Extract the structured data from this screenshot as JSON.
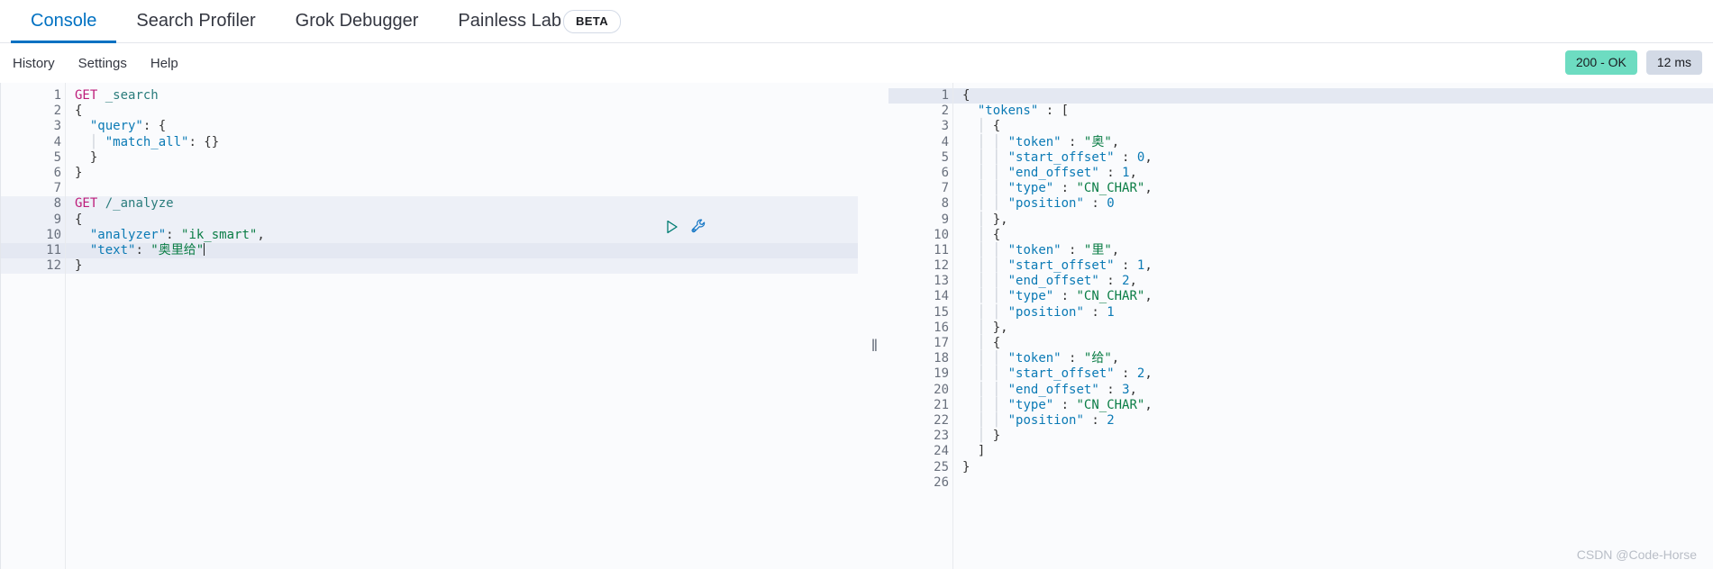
{
  "tabs": [
    {
      "label": "Console",
      "active": true
    },
    {
      "label": "Search Profiler",
      "active": false
    },
    {
      "label": "Grok Debugger",
      "active": false
    },
    {
      "label": "Painless Lab",
      "active": false
    }
  ],
  "beta_badge": "BETA",
  "subnav": [
    {
      "label": "History"
    },
    {
      "label": "Settings"
    },
    {
      "label": "Help"
    }
  ],
  "status": {
    "code": "200 - OK",
    "time": "12 ms",
    "ok_color": "#6ddcc1",
    "time_color": "#d3dae6"
  },
  "request_editor": {
    "lines": [
      {
        "n": "1",
        "fold": "",
        "highlight": "none",
        "tokens": [
          {
            "t": "GET",
            "c": "method"
          },
          {
            "t": " ",
            "c": "punct"
          },
          {
            "t": "_search",
            "c": "url"
          }
        ]
      },
      {
        "n": "2",
        "fold": "▾",
        "highlight": "none",
        "tokens": [
          {
            "t": "{",
            "c": "punct"
          }
        ]
      },
      {
        "n": "3",
        "fold": "▾",
        "highlight": "none",
        "tokens": [
          {
            "t": "  ",
            "c": "punct"
          },
          {
            "t": "\"query\"",
            "c": "key"
          },
          {
            "t": ": {",
            "c": "punct"
          }
        ]
      },
      {
        "n": "4",
        "fold": "",
        "highlight": "none",
        "tokens": [
          {
            "t": "  ",
            "c": "punct"
          },
          {
            "t": "│",
            "c": "guide"
          },
          {
            "t": " ",
            "c": "punct"
          },
          {
            "t": "\"match_all\"",
            "c": "key"
          },
          {
            "t": ": {}",
            "c": "punct"
          }
        ]
      },
      {
        "n": "5",
        "fold": "▴",
        "highlight": "none",
        "tokens": [
          {
            "t": "  }",
            "c": "punct"
          }
        ]
      },
      {
        "n": "6",
        "fold": "▴",
        "highlight": "none",
        "tokens": [
          {
            "t": "}",
            "c": "punct"
          }
        ]
      },
      {
        "n": "7",
        "fold": "",
        "highlight": "none",
        "tokens": []
      },
      {
        "n": "8",
        "fold": "",
        "highlight": "soft",
        "tokens": [
          {
            "t": "GET",
            "c": "method"
          },
          {
            "t": " ",
            "c": "punct"
          },
          {
            "t": "/_analyze",
            "c": "url"
          }
        ]
      },
      {
        "n": "9",
        "fold": "▾",
        "highlight": "soft",
        "tokens": [
          {
            "t": "{",
            "c": "punct"
          }
        ]
      },
      {
        "n": "10",
        "fold": "",
        "highlight": "soft",
        "tokens": [
          {
            "t": "  ",
            "c": "punct"
          },
          {
            "t": "\"analyzer\"",
            "c": "key"
          },
          {
            "t": ": ",
            "c": "punct"
          },
          {
            "t": "\"ik_smart\"",
            "c": "str"
          },
          {
            "t": ",",
            "c": "punct"
          }
        ]
      },
      {
        "n": "11",
        "fold": "",
        "highlight": "strong",
        "caret": true,
        "tokens": [
          {
            "t": "  ",
            "c": "punct"
          },
          {
            "t": "\"text\"",
            "c": "key"
          },
          {
            "t": ": ",
            "c": "punct"
          },
          {
            "t": "\"奥里给\"",
            "c": "str"
          }
        ]
      },
      {
        "n": "12",
        "fold": "▴",
        "highlight": "soft",
        "tokens": [
          {
            "t": "}",
            "c": "punct"
          }
        ]
      }
    ],
    "play_icon": "play-icon",
    "wrench_icon": "wrench-icon"
  },
  "response_editor": {
    "lines": [
      {
        "n": "1",
        "fold": "▾",
        "highlight": "strong",
        "tokens": [
          {
            "t": "{",
            "c": "punct"
          }
        ]
      },
      {
        "n": "2",
        "fold": "▾",
        "highlight": "none",
        "tokens": [
          {
            "t": "  ",
            "c": "punct"
          },
          {
            "t": "\"tokens\"",
            "c": "key"
          },
          {
            "t": " : [",
            "c": "punct"
          }
        ]
      },
      {
        "n": "3",
        "fold": "▾",
        "highlight": "none",
        "tokens": [
          {
            "t": "  ",
            "c": "punct"
          },
          {
            "t": "│",
            "c": "guide"
          },
          {
            "t": " {",
            "c": "punct"
          }
        ]
      },
      {
        "n": "4",
        "fold": "",
        "highlight": "none",
        "tokens": [
          {
            "t": "  ",
            "c": "punct"
          },
          {
            "t": "│",
            "c": "guide"
          },
          {
            "t": " ",
            "c": "punct"
          },
          {
            "t": "│",
            "c": "guide"
          },
          {
            "t": " ",
            "c": "punct"
          },
          {
            "t": "\"token\"",
            "c": "key"
          },
          {
            "t": " : ",
            "c": "punct"
          },
          {
            "t": "\"奥\"",
            "c": "str"
          },
          {
            "t": ",",
            "c": "punct"
          }
        ]
      },
      {
        "n": "5",
        "fold": "",
        "highlight": "none",
        "tokens": [
          {
            "t": "  ",
            "c": "punct"
          },
          {
            "t": "│",
            "c": "guide"
          },
          {
            "t": " ",
            "c": "punct"
          },
          {
            "t": "│",
            "c": "guide"
          },
          {
            "t": " ",
            "c": "punct"
          },
          {
            "t": "\"start_offset\"",
            "c": "key"
          },
          {
            "t": " : ",
            "c": "punct"
          },
          {
            "t": "0",
            "c": "num"
          },
          {
            "t": ",",
            "c": "punct"
          }
        ]
      },
      {
        "n": "6",
        "fold": "",
        "highlight": "none",
        "tokens": [
          {
            "t": "  ",
            "c": "punct"
          },
          {
            "t": "│",
            "c": "guide"
          },
          {
            "t": " ",
            "c": "punct"
          },
          {
            "t": "│",
            "c": "guide"
          },
          {
            "t": " ",
            "c": "punct"
          },
          {
            "t": "\"end_offset\"",
            "c": "key"
          },
          {
            "t": " : ",
            "c": "punct"
          },
          {
            "t": "1",
            "c": "num"
          },
          {
            "t": ",",
            "c": "punct"
          }
        ]
      },
      {
        "n": "7",
        "fold": "",
        "highlight": "none",
        "tokens": [
          {
            "t": "  ",
            "c": "punct"
          },
          {
            "t": "│",
            "c": "guide"
          },
          {
            "t": " ",
            "c": "punct"
          },
          {
            "t": "│",
            "c": "guide"
          },
          {
            "t": " ",
            "c": "punct"
          },
          {
            "t": "\"type\"",
            "c": "key"
          },
          {
            "t": " : ",
            "c": "punct"
          },
          {
            "t": "\"CN_CHAR\"",
            "c": "str"
          },
          {
            "t": ",",
            "c": "punct"
          }
        ]
      },
      {
        "n": "8",
        "fold": "",
        "highlight": "none",
        "tokens": [
          {
            "t": "  ",
            "c": "punct"
          },
          {
            "t": "│",
            "c": "guide"
          },
          {
            "t": " ",
            "c": "punct"
          },
          {
            "t": "│",
            "c": "guide"
          },
          {
            "t": " ",
            "c": "punct"
          },
          {
            "t": "\"position\"",
            "c": "key"
          },
          {
            "t": " : ",
            "c": "punct"
          },
          {
            "t": "0",
            "c": "num"
          }
        ]
      },
      {
        "n": "9",
        "fold": "▴",
        "highlight": "none",
        "tokens": [
          {
            "t": "  ",
            "c": "punct"
          },
          {
            "t": "│",
            "c": "guide"
          },
          {
            "t": " },",
            "c": "punct"
          }
        ]
      },
      {
        "n": "10",
        "fold": "▾",
        "highlight": "none",
        "tokens": [
          {
            "t": "  ",
            "c": "punct"
          },
          {
            "t": "│",
            "c": "guide"
          },
          {
            "t": " {",
            "c": "punct"
          }
        ]
      },
      {
        "n": "11",
        "fold": "",
        "highlight": "none",
        "tokens": [
          {
            "t": "  ",
            "c": "punct"
          },
          {
            "t": "│",
            "c": "guide"
          },
          {
            "t": " ",
            "c": "punct"
          },
          {
            "t": "│",
            "c": "guide"
          },
          {
            "t": " ",
            "c": "punct"
          },
          {
            "t": "\"token\"",
            "c": "key"
          },
          {
            "t": " : ",
            "c": "punct"
          },
          {
            "t": "\"里\"",
            "c": "str"
          },
          {
            "t": ",",
            "c": "punct"
          }
        ]
      },
      {
        "n": "12",
        "fold": "",
        "highlight": "none",
        "tokens": [
          {
            "t": "  ",
            "c": "punct"
          },
          {
            "t": "│",
            "c": "guide"
          },
          {
            "t": " ",
            "c": "punct"
          },
          {
            "t": "│",
            "c": "guide"
          },
          {
            "t": " ",
            "c": "punct"
          },
          {
            "t": "\"start_offset\"",
            "c": "key"
          },
          {
            "t": " : ",
            "c": "punct"
          },
          {
            "t": "1",
            "c": "num"
          },
          {
            "t": ",",
            "c": "punct"
          }
        ]
      },
      {
        "n": "13",
        "fold": "",
        "highlight": "none",
        "tokens": [
          {
            "t": "  ",
            "c": "punct"
          },
          {
            "t": "│",
            "c": "guide"
          },
          {
            "t": " ",
            "c": "punct"
          },
          {
            "t": "│",
            "c": "guide"
          },
          {
            "t": " ",
            "c": "punct"
          },
          {
            "t": "\"end_offset\"",
            "c": "key"
          },
          {
            "t": " : ",
            "c": "punct"
          },
          {
            "t": "2",
            "c": "num"
          },
          {
            "t": ",",
            "c": "punct"
          }
        ]
      },
      {
        "n": "14",
        "fold": "",
        "highlight": "none",
        "tokens": [
          {
            "t": "  ",
            "c": "punct"
          },
          {
            "t": "│",
            "c": "guide"
          },
          {
            "t": " ",
            "c": "punct"
          },
          {
            "t": "│",
            "c": "guide"
          },
          {
            "t": " ",
            "c": "punct"
          },
          {
            "t": "\"type\"",
            "c": "key"
          },
          {
            "t": " : ",
            "c": "punct"
          },
          {
            "t": "\"CN_CHAR\"",
            "c": "str"
          },
          {
            "t": ",",
            "c": "punct"
          }
        ]
      },
      {
        "n": "15",
        "fold": "",
        "highlight": "none",
        "tokens": [
          {
            "t": "  ",
            "c": "punct"
          },
          {
            "t": "│",
            "c": "guide"
          },
          {
            "t": " ",
            "c": "punct"
          },
          {
            "t": "│",
            "c": "guide"
          },
          {
            "t": " ",
            "c": "punct"
          },
          {
            "t": "\"position\"",
            "c": "key"
          },
          {
            "t": " : ",
            "c": "punct"
          },
          {
            "t": "1",
            "c": "num"
          }
        ]
      },
      {
        "n": "16",
        "fold": "▴",
        "highlight": "none",
        "tokens": [
          {
            "t": "  ",
            "c": "punct"
          },
          {
            "t": "│",
            "c": "guide"
          },
          {
            "t": " },",
            "c": "punct"
          }
        ]
      },
      {
        "n": "17",
        "fold": "▾",
        "highlight": "none",
        "tokens": [
          {
            "t": "  ",
            "c": "punct"
          },
          {
            "t": "│",
            "c": "guide"
          },
          {
            "t": " {",
            "c": "punct"
          }
        ]
      },
      {
        "n": "18",
        "fold": "",
        "highlight": "none",
        "tokens": [
          {
            "t": "  ",
            "c": "punct"
          },
          {
            "t": "│",
            "c": "guide"
          },
          {
            "t": " ",
            "c": "punct"
          },
          {
            "t": "│",
            "c": "guide"
          },
          {
            "t": " ",
            "c": "punct"
          },
          {
            "t": "\"token\"",
            "c": "key"
          },
          {
            "t": " : ",
            "c": "punct"
          },
          {
            "t": "\"给\"",
            "c": "str"
          },
          {
            "t": ",",
            "c": "punct"
          }
        ]
      },
      {
        "n": "19",
        "fold": "",
        "highlight": "none",
        "tokens": [
          {
            "t": "  ",
            "c": "punct"
          },
          {
            "t": "│",
            "c": "guide"
          },
          {
            "t": " ",
            "c": "punct"
          },
          {
            "t": "│",
            "c": "guide"
          },
          {
            "t": " ",
            "c": "punct"
          },
          {
            "t": "\"start_offset\"",
            "c": "key"
          },
          {
            "t": " : ",
            "c": "punct"
          },
          {
            "t": "2",
            "c": "num"
          },
          {
            "t": ",",
            "c": "punct"
          }
        ]
      },
      {
        "n": "20",
        "fold": "",
        "highlight": "none",
        "tokens": [
          {
            "t": "  ",
            "c": "punct"
          },
          {
            "t": "│",
            "c": "guide"
          },
          {
            "t": " ",
            "c": "punct"
          },
          {
            "t": "│",
            "c": "guide"
          },
          {
            "t": " ",
            "c": "punct"
          },
          {
            "t": "\"end_offset\"",
            "c": "key"
          },
          {
            "t": " : ",
            "c": "punct"
          },
          {
            "t": "3",
            "c": "num"
          },
          {
            "t": ",",
            "c": "punct"
          }
        ]
      },
      {
        "n": "21",
        "fold": "",
        "highlight": "none",
        "tokens": [
          {
            "t": "  ",
            "c": "punct"
          },
          {
            "t": "│",
            "c": "guide"
          },
          {
            "t": " ",
            "c": "punct"
          },
          {
            "t": "│",
            "c": "guide"
          },
          {
            "t": " ",
            "c": "punct"
          },
          {
            "t": "\"type\"",
            "c": "key"
          },
          {
            "t": " : ",
            "c": "punct"
          },
          {
            "t": "\"CN_CHAR\"",
            "c": "str"
          },
          {
            "t": ",",
            "c": "punct"
          }
        ]
      },
      {
        "n": "22",
        "fold": "",
        "highlight": "none",
        "tokens": [
          {
            "t": "  ",
            "c": "punct"
          },
          {
            "t": "│",
            "c": "guide"
          },
          {
            "t": " ",
            "c": "punct"
          },
          {
            "t": "│",
            "c": "guide"
          },
          {
            "t": " ",
            "c": "punct"
          },
          {
            "t": "\"position\"",
            "c": "key"
          },
          {
            "t": " : ",
            "c": "punct"
          },
          {
            "t": "2",
            "c": "num"
          }
        ]
      },
      {
        "n": "23",
        "fold": "▴",
        "highlight": "none",
        "tokens": [
          {
            "t": "  ",
            "c": "punct"
          },
          {
            "t": "│",
            "c": "guide"
          },
          {
            "t": " }",
            "c": "punct"
          }
        ]
      },
      {
        "n": "24",
        "fold": "▴",
        "highlight": "none",
        "tokens": [
          {
            "t": "  ]",
            "c": "punct"
          }
        ]
      },
      {
        "n": "25",
        "fold": "▴",
        "highlight": "none",
        "tokens": [
          {
            "t": "}",
            "c": "punct"
          }
        ]
      },
      {
        "n": "26",
        "fold": "",
        "highlight": "none",
        "tokens": []
      }
    ]
  },
  "splitter": {
    "grip": "‖"
  },
  "watermark": "CSDN @Code-Horse"
}
